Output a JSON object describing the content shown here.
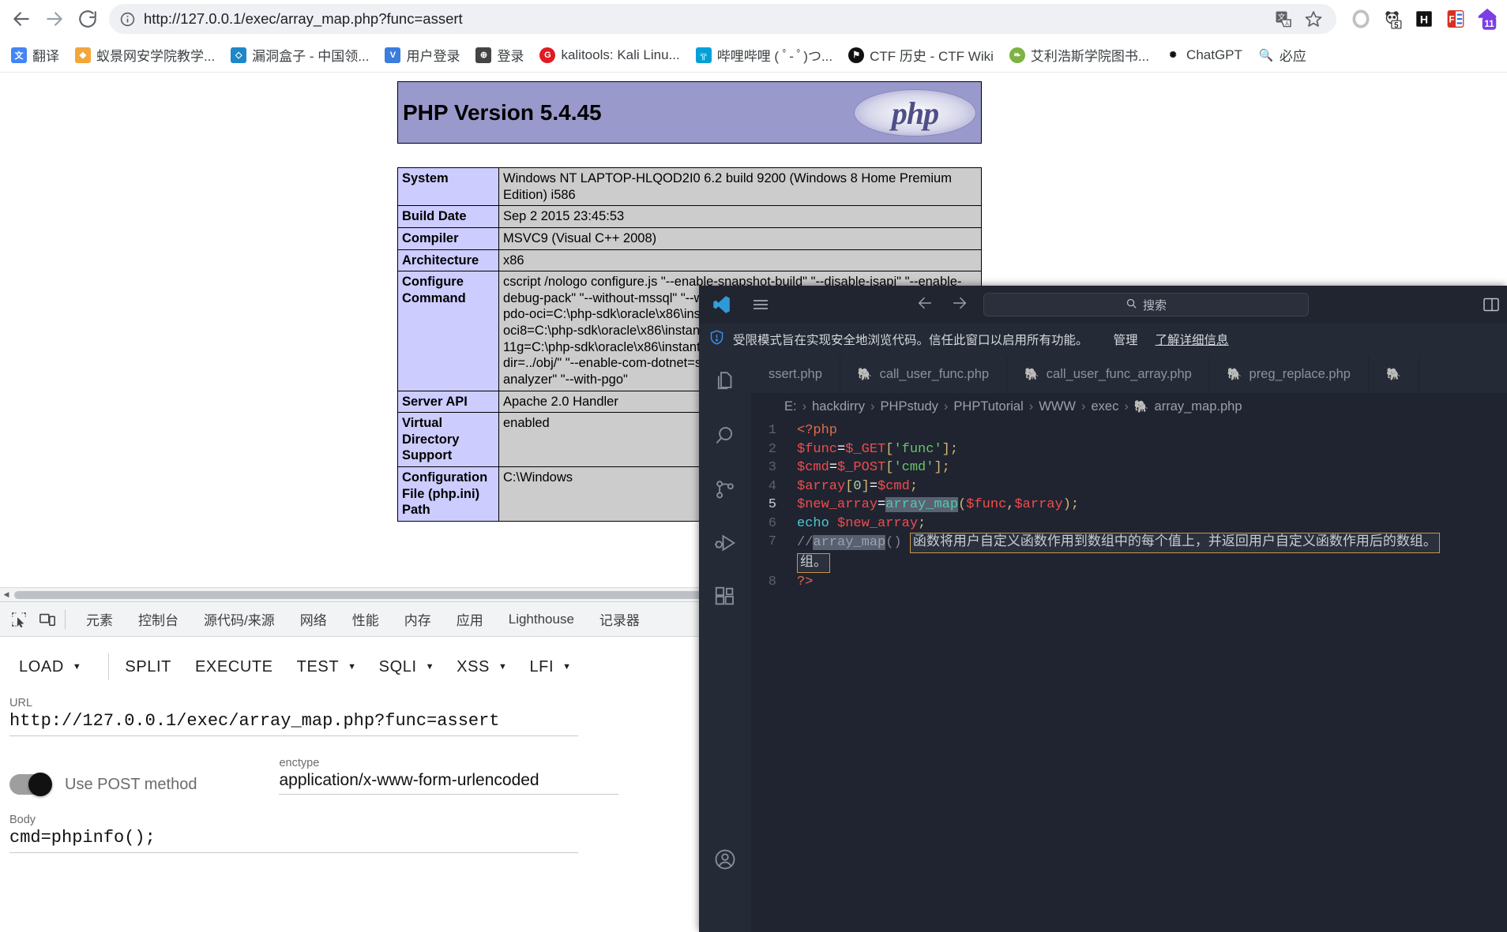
{
  "browser": {
    "back_icon": "back-arrow-icon",
    "forward_icon": "forward-arrow-icon",
    "reload_icon": "reload-icon",
    "url": "http://127.0.0.1/exec/array_map.php?func=assert",
    "site_info_icon": "site-info-icon",
    "translate_icon": "translate-icon",
    "bookmark_star_icon": "star-icon",
    "extensions": [
      {
        "name": "extension-ring-icon",
        "label": "",
        "color": "#c8c8c8"
      },
      {
        "name": "extension-panda-icon",
        "label": "5",
        "color": "#3c3c3c"
      },
      {
        "name": "extension-hackbar-icon",
        "label": "H",
        "color": "#000000"
      },
      {
        "name": "extension-foxyproxy-icon",
        "label": "FE",
        "color": "#d93025"
      },
      {
        "name": "extension-profile-icon",
        "label": "11",
        "color": "#7b3fe4"
      }
    ],
    "bookmarks": [
      {
        "label": "翻译",
        "icon": "translate-bookmark-icon",
        "color": "#4285f4"
      },
      {
        "label": "蚁景网安学院教学...",
        "icon": "diamond-icon",
        "color": "#f2a63b"
      },
      {
        "label": "漏洞盒子 - 中国领...",
        "icon": "shield-icon",
        "color": "#1e88c7"
      },
      {
        "label": "用户登录",
        "icon": "v-icon",
        "color": "#3b7ddd"
      },
      {
        "label": "登录",
        "icon": "globe-icon",
        "color": "#444444"
      },
      {
        "label": "kalitools: Kali Linu...",
        "icon": "g-icon",
        "color": "#e01b24"
      },
      {
        "label": "哔哩哔哩 ( ﾟ- ﾟ)つ...",
        "icon": "bilibili-icon",
        "color": "#00a1d6"
      },
      {
        "label": "CTF 历史 - CTF Wiki",
        "icon": "ctf-icon",
        "color": "#111111"
      },
      {
        "label": "艾利浩斯学院图书...",
        "icon": "leaf-icon",
        "color": "#7cb342"
      },
      {
        "label": "ChatGPT",
        "icon": "chatgpt-icon",
        "color": "#10a37f"
      },
      {
        "label": "必应",
        "icon": "bing-search-icon",
        "color": "#174ea6"
      }
    ]
  },
  "phpinfo": {
    "title": "PHP Version 5.4.45",
    "logo_text": "php",
    "rows": [
      {
        "key": "System",
        "value": "Windows NT LAPTOP-HLQOD2I0 6.2 build 9200 (Windows 8 Home Premium Edition) i586"
      },
      {
        "key": "Build Date",
        "value": "Sep 2 2015 23:45:53"
      },
      {
        "key": "Compiler",
        "value": "MSVC9 (Visual C++ 2008)"
      },
      {
        "key": "Architecture",
        "value": "x86"
      },
      {
        "key": "Configure Command",
        "value": "cscript /nologo configure.js  \"--enable-snapshot-build\" \"--disable-isapi\" \"--enable-debug-pack\" \"--without-mssql\" \"--without-pdo-mssql\" \"--without-pi3web\" \"--with-pdo-oci=C:\\php-sdk\\oracle\\x86\\instantclient_12_1\\sdk,shared\" \"--with-oci8=C:\\php-sdk\\oracle\\x86\\instantclient_12_1\\sdk,shared\" \"--with-oci8-11g=C:\\php-sdk\\oracle\\x86\\instantclient_12_1\\sdk,shared\" \"--enable-object-out-dir=../obj/\" \"--enable-com-dotnet=shared\" \"--with-mcrypt=static\" \"--without-analyzer\" \"--with-pgo\""
      },
      {
        "key": "Server API",
        "value": "Apache 2.0 Handler"
      },
      {
        "key": "Virtual Directory Support",
        "value": "enabled"
      },
      {
        "key": "Configuration File (php.ini) Path",
        "value": "C:\\Windows"
      }
    ]
  },
  "devtools": {
    "inspect_icon": "inspect-element-icon",
    "device_icon": "device-toolbar-icon",
    "tabs": [
      "元素",
      "控制台",
      "源代码/来源",
      "网络",
      "性能",
      "内存",
      "应用",
      "Lighthouse",
      "记录器"
    ]
  },
  "hackbar": {
    "buttons": [
      {
        "label": "LOAD",
        "has_caret": true,
        "separator_after": true
      },
      {
        "label": "SPLIT",
        "has_caret": false,
        "separator_after": false
      },
      {
        "label": "EXECUTE",
        "has_caret": false,
        "separator_after": false
      },
      {
        "label": "TEST",
        "has_caret": true,
        "separator_after": false
      },
      {
        "label": "SQLI",
        "has_caret": true,
        "separator_after": false
      },
      {
        "label": "XSS",
        "has_caret": true,
        "separator_after": false
      },
      {
        "label": "LFI",
        "has_caret": true,
        "separator_after": false
      }
    ],
    "url_label": "URL",
    "url_value": "http://127.0.0.1/exec/array_map.php?func=assert",
    "post_toggle_label": "Use POST method",
    "post_toggle_on": true,
    "enctype_label": "enctype",
    "enctype_value": "application/x-www-form-urlencoded",
    "body_label": "Body",
    "body_value": "cmd=phpinfo();"
  },
  "vscode": {
    "logo_icon": "vscode-logo-icon",
    "menu_icon": "hamburger-menu-icon",
    "back_icon": "editor-back-icon",
    "forward_icon": "editor-forward-icon",
    "search_placeholder": "搜索",
    "search_icon": "search-icon",
    "layout_icon": "toggle-panel-icon",
    "banner": {
      "shield_icon": "shield-warning-icon",
      "text": "受限模式旨在实现安全地浏览代码。信任此窗口以启用所有功能。",
      "manage_link": "管理",
      "learn_link": "了解详细信息"
    },
    "activity_icons": [
      "explorer-files-icon",
      "search-icon",
      "source-control-icon",
      "run-and-debug-icon",
      "extensions-icon"
    ],
    "account_icon": "account-icon",
    "tabs": [
      {
        "label": "ssert.php",
        "active": false,
        "php": false
      },
      {
        "label": "call_user_func.php",
        "active": false,
        "php": true
      },
      {
        "label": "call_user_func_array.php",
        "active": false,
        "php": true
      },
      {
        "label": "preg_replace.php",
        "active": false,
        "php": true
      }
    ],
    "breadcrumb": [
      "E:",
      "hackdirry",
      "PHPstudy",
      "PHPTutorial",
      "WWW",
      "exec",
      "array_map.php"
    ],
    "code_lines": [
      {
        "n": "1",
        "text": "<?php"
      },
      {
        "n": "2",
        "text": "$func=$_GET['func'];"
      },
      {
        "n": "3",
        "text": "$cmd=$_POST['cmd'];"
      },
      {
        "n": "4",
        "text": "$array[0]=$cmd;"
      },
      {
        "n": "5",
        "text": "$new_array=array_map($func,$array);"
      },
      {
        "n": "6",
        "text": "echo $new_array;"
      },
      {
        "n": "7",
        "text": "//array_map() 函数将用户自定义函数作用到数组中的每个值上，并返回用户自定义函数作用后的带有新的值的数组。"
      },
      {
        "n": "8",
        "text": "?>"
      }
    ],
    "tooltip_text": "函数将用户自定义函数作用到数组中的每个值上，并返回用户自定义函数作用后的数组。",
    "tooltip_tail": "组。",
    "highlight_word": "array_map",
    "current_line": "5"
  }
}
